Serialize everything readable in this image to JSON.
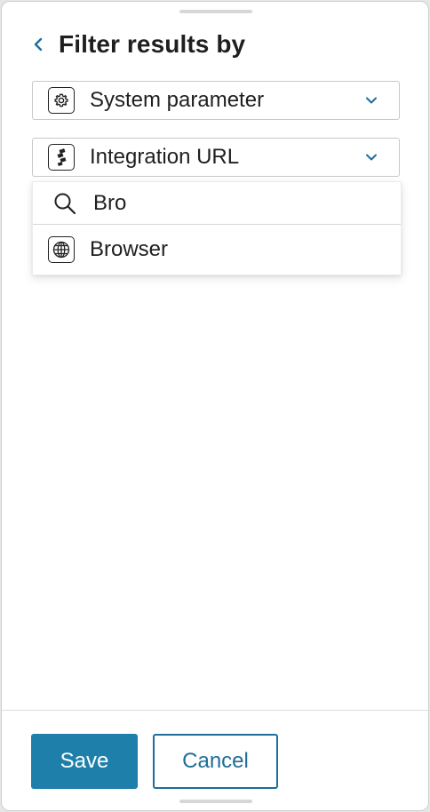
{
  "header": {
    "title": "Filter results by"
  },
  "filters": [
    {
      "label": "System parameter",
      "icon": "gear-icon"
    },
    {
      "label": "Integration URL",
      "icon": "integration-icon"
    }
  ],
  "dropdown": {
    "search_value": "Bro",
    "options": [
      {
        "label": "Browser",
        "icon": "globe-icon"
      }
    ]
  },
  "footer": {
    "save_label": "Save",
    "cancel_label": "Cancel"
  },
  "colors": {
    "primary": "#1e7fab",
    "link": "#1e6e99"
  }
}
